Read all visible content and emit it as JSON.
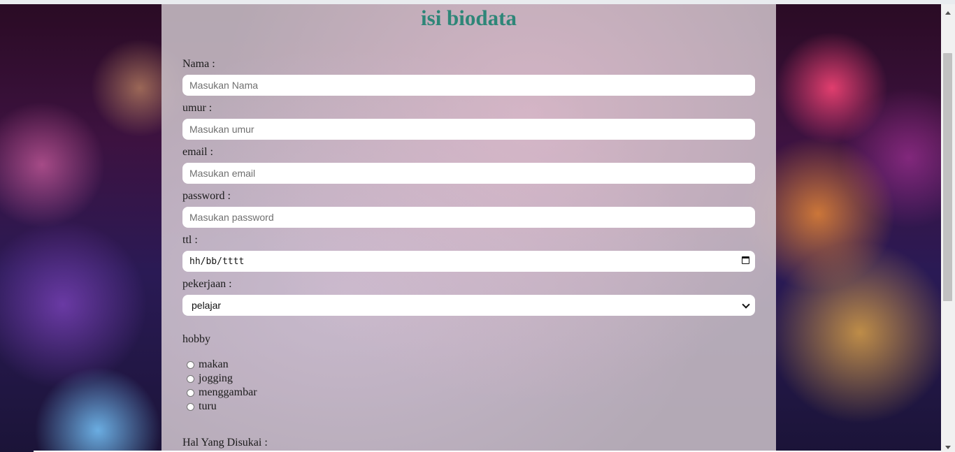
{
  "form": {
    "title": "isi biodata",
    "fields": [
      {
        "label": "Nama :",
        "placeholder": "Masukan Nama"
      },
      {
        "label": "umur :",
        "placeholder": "Masukan umur"
      },
      {
        "label": "email :",
        "placeholder": "Masukan email"
      },
      {
        "label": "password :",
        "placeholder": "Masukan password"
      }
    ],
    "ttl": {
      "label": "ttl :",
      "value": "hh/bb/tttt"
    },
    "pekerjaan": {
      "label": "pekerjaan :",
      "selected": "pelajar"
    },
    "hobby": {
      "label": "hobby",
      "options": [
        "makan",
        "jogging",
        "menggambar",
        "turu"
      ]
    },
    "disukai": {
      "label": "Hal Yang Disukai :"
    }
  },
  "colors": {
    "title": "#2e8678",
    "panel": "#c8bec6"
  }
}
